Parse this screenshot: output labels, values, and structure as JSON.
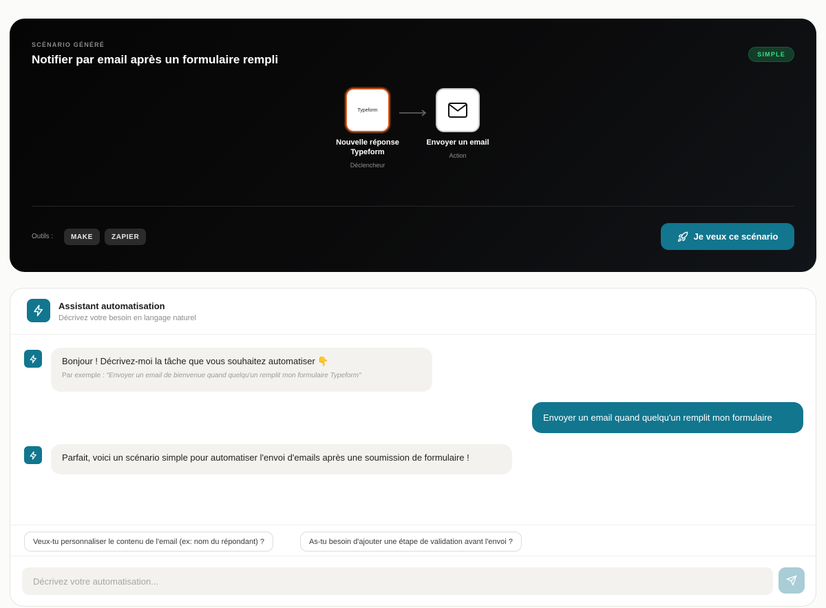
{
  "scenario": {
    "kicker": "SCÉNARIO GÉNÉRÉ",
    "title": "Notifier par email après un formulaire rempli",
    "level_badge": "SIMPLE",
    "nodes": [
      {
        "logo_text": "Typeform",
        "name": "Nouvelle réponse Typeform",
        "role": "Déclencheur",
        "icon": "typeform-logo"
      },
      {
        "name": "Envoyer un email",
        "role": "Action",
        "icon": "mail-icon"
      }
    ],
    "tools_label": "Outils :",
    "tools": [
      "MAKE",
      "ZAPIER"
    ],
    "cta_label": "Je veux ce scénario",
    "cta_icon": "rocket-icon",
    "colors": {
      "accent": "#12768f",
      "badge_green": "#3ddc84",
      "trigger_border": "#d65a1f"
    }
  },
  "assistant": {
    "title": "Assistant automatisation",
    "subtitle": "Décrivez votre besoin en langage naturel",
    "icon": "lightning-icon",
    "messages": [
      {
        "from": "bot",
        "text": "Bonjour ! Décrivez-moi la tâche que vous souhaitez automatiser 👇",
        "hint_prefix": "Par exemple : ",
        "hint_example": "\"Envoyer un email de bienvenue quand quelqu'un remplit mon formulaire Typeform\""
      },
      {
        "from": "user",
        "text": "Envoyer un email quand quelqu'un remplit mon formulaire"
      },
      {
        "from": "bot",
        "text": "Parfait, voici un scénario simple pour automatiser l'envoi d'emails après une soumission de formulaire !"
      }
    ],
    "suggestions": [
      "Veux-tu personnaliser le contenu de l'email (ex: nom du répondant) ?",
      "As-tu besoin d'ajouter une étape de validation avant l'envoi ?"
    ],
    "input_placeholder": "Décrivez votre automatisation...",
    "send_icon": "send-icon"
  }
}
